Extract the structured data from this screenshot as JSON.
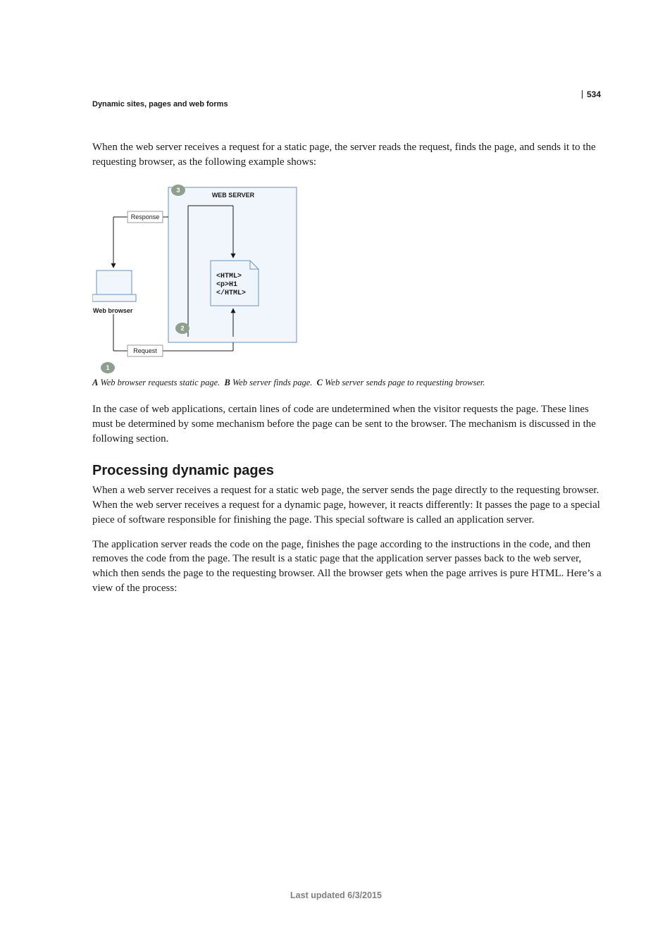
{
  "page_number": "534",
  "running_head": "Dynamic sites, pages and web forms",
  "para1": "When the web server receives a request for a static page, the server reads the request, finds the page, and sends it to the requesting browser, as the following example shows:",
  "caption": {
    "A_key": "A",
    "A_text": "Web browser requests static page.",
    "B_key": "B",
    "B_text": "Web server finds page.",
    "C_key": "C",
    "C_text": "Web server sends page to requesting browser."
  },
  "para2": "In the case of web applications, certain lines of code are undetermined when the visitor requests the page. These lines must be determined by some mechanism before the page can be sent to the browser. The mechanism is discussed in the following section.",
  "section_heading": "Processing dynamic pages",
  "para3": "When a web server receives a request for a static web page, the server sends the page directly to the requesting browser. When the web server receives a request for a dynamic page, however, it reacts differently: It passes the page to a special piece of software responsible for finishing the page. This special software is called an application server.",
  "para4": "The application server reads the code on the page, finishes the page according to the instructions in the code, and then removes the code from the page. The result is a static page that the application server passes back to the web server, which then sends the page to the requesting browser. All the browser gets when the page arrives is pure HTML. Here’s a view of the process:",
  "footer": "Last updated 6/3/2015",
  "diagram": {
    "web_server_label": "WEB SERVER",
    "response_label": "Response",
    "request_label": "Request",
    "web_browser_label": "Web browser",
    "html_l1": "<HTML>",
    "html_l2": "<p>H1",
    "html_l3": "</HTML>",
    "badge1": "1",
    "badge2": "2",
    "badge3": "3"
  }
}
